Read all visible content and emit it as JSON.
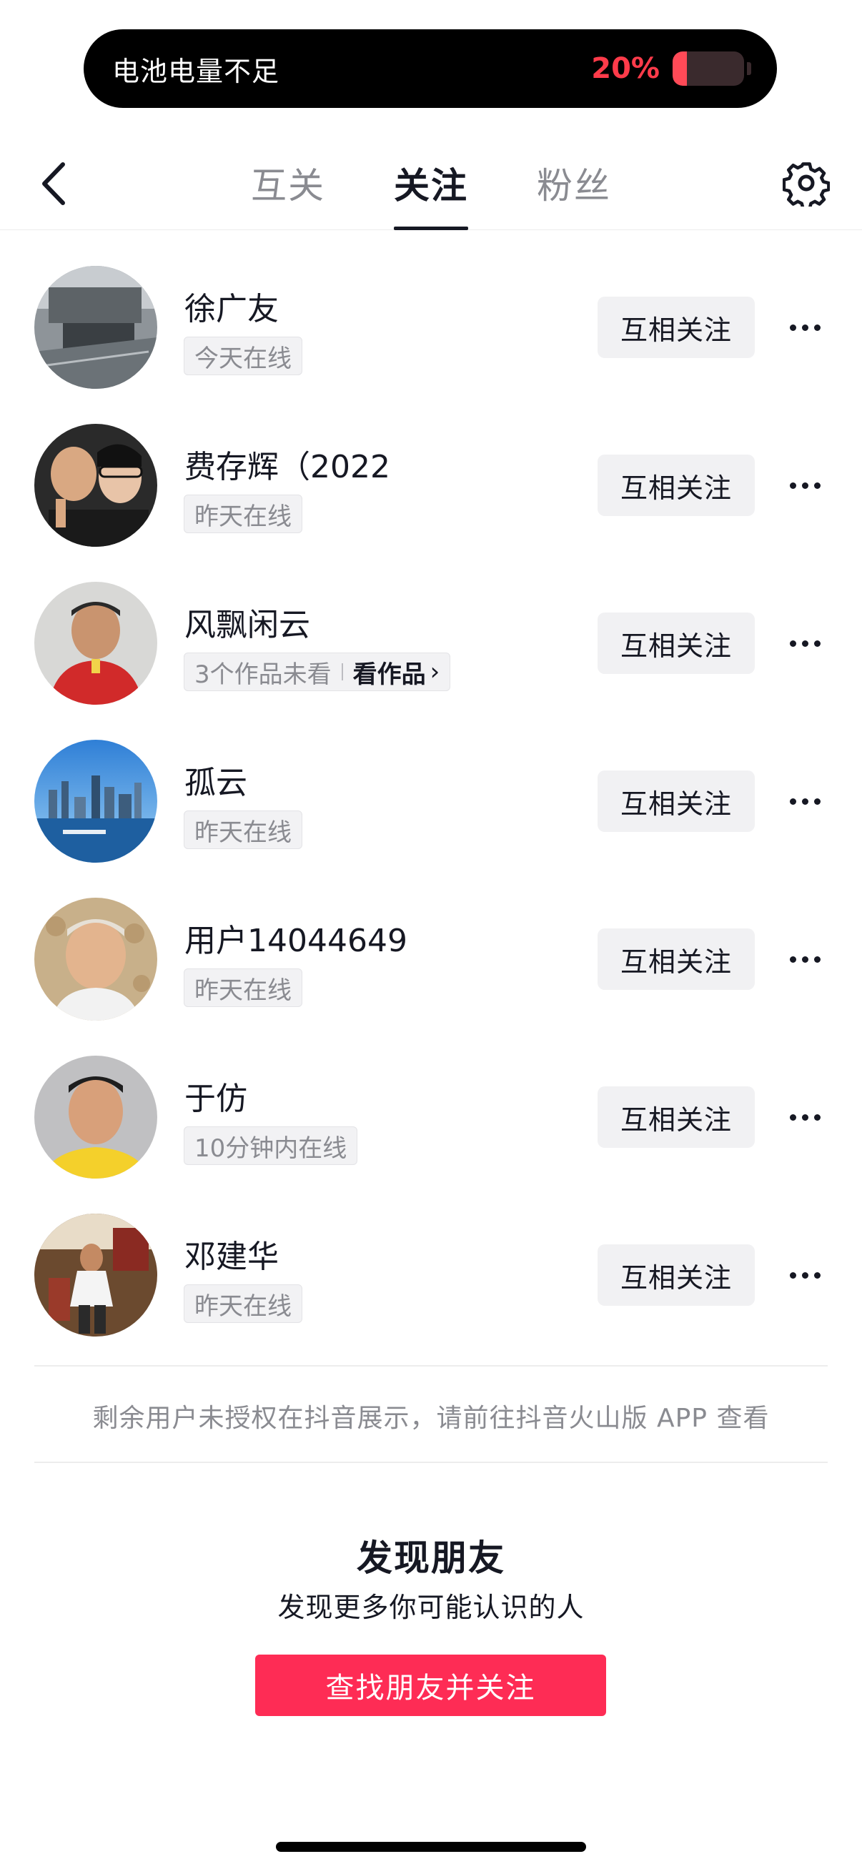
{
  "banner": {
    "message": "电池电量不足",
    "battery_percent": "20%",
    "battery_level": 0.2,
    "accent_color": "#ff3b4a"
  },
  "header": {
    "back_icon": "chevron-left-icon",
    "settings_icon": "gear-icon",
    "tabs": [
      {
        "label": "互关",
        "active": false
      },
      {
        "label": "关注",
        "active": true
      },
      {
        "label": "粉丝",
        "active": false
      }
    ]
  },
  "users": [
    {
      "name": "徐广友",
      "status": "今天在线",
      "button": "互相关注"
    },
    {
      "name": "费存辉（2022",
      "status": "昨天在线",
      "button": "互相关注"
    },
    {
      "name": "风飘闲云",
      "status": "3个作品未看",
      "works_link": "看作品",
      "button": "互相关注"
    },
    {
      "name": "孤云",
      "status": "昨天在线",
      "button": "互相关注"
    },
    {
      "name": "用户14044649",
      "status": "昨天在线",
      "button": "互相关注"
    },
    {
      "name": "于仿",
      "status": "10分钟内在线",
      "button": "互相关注"
    },
    {
      "name": "邓建华",
      "status": "昨天在线",
      "button": "互相关注"
    }
  ],
  "notice": "剩余用户未授权在抖音展示，请前往抖音火山版 APP 查看",
  "discover": {
    "title": "发现朋友",
    "subtitle": "发现更多你可能认识的人",
    "button": "查找朋友并关注",
    "button_color": "#fe2c55"
  }
}
